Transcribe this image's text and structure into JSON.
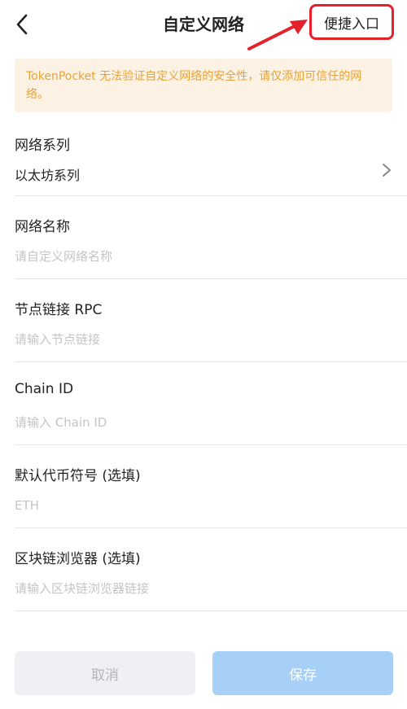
{
  "header": {
    "title": "自定义网络",
    "quick_entry_label": "便捷入口"
  },
  "warning": {
    "text": "TokenPocket 无法验证自定义网络的安全性，请仅添加可信任的网络。",
    "color": "#e8a23a",
    "background": "#fcf2e3"
  },
  "form": {
    "network_series": {
      "label": "网络系列",
      "value": "以太坊系列"
    },
    "network_name": {
      "label": "网络名称",
      "placeholder": "请自定义网络名称"
    },
    "rpc": {
      "label": "节点链接 RPC",
      "placeholder": "请输入节点链接"
    },
    "chain_id": {
      "label": "Chain ID",
      "placeholder": "请输入 Chain ID"
    },
    "symbol": {
      "label": "默认代币符号 (选填)",
      "placeholder": "ETH"
    },
    "explorer": {
      "label": "区块链浏览器 (选填)",
      "placeholder": "请输入区块链浏览器链接"
    }
  },
  "actions": {
    "cancel_label": "取消",
    "save_label": "保存"
  },
  "colors": {
    "highlight": "#e5202a",
    "save_button": "#a7d0f7",
    "cancel_button": "#eef0f3"
  },
  "icons": {
    "back": "back-arrow-icon",
    "chevron": "chevron-right-icon",
    "annotation": "red-arrow-annotation"
  }
}
